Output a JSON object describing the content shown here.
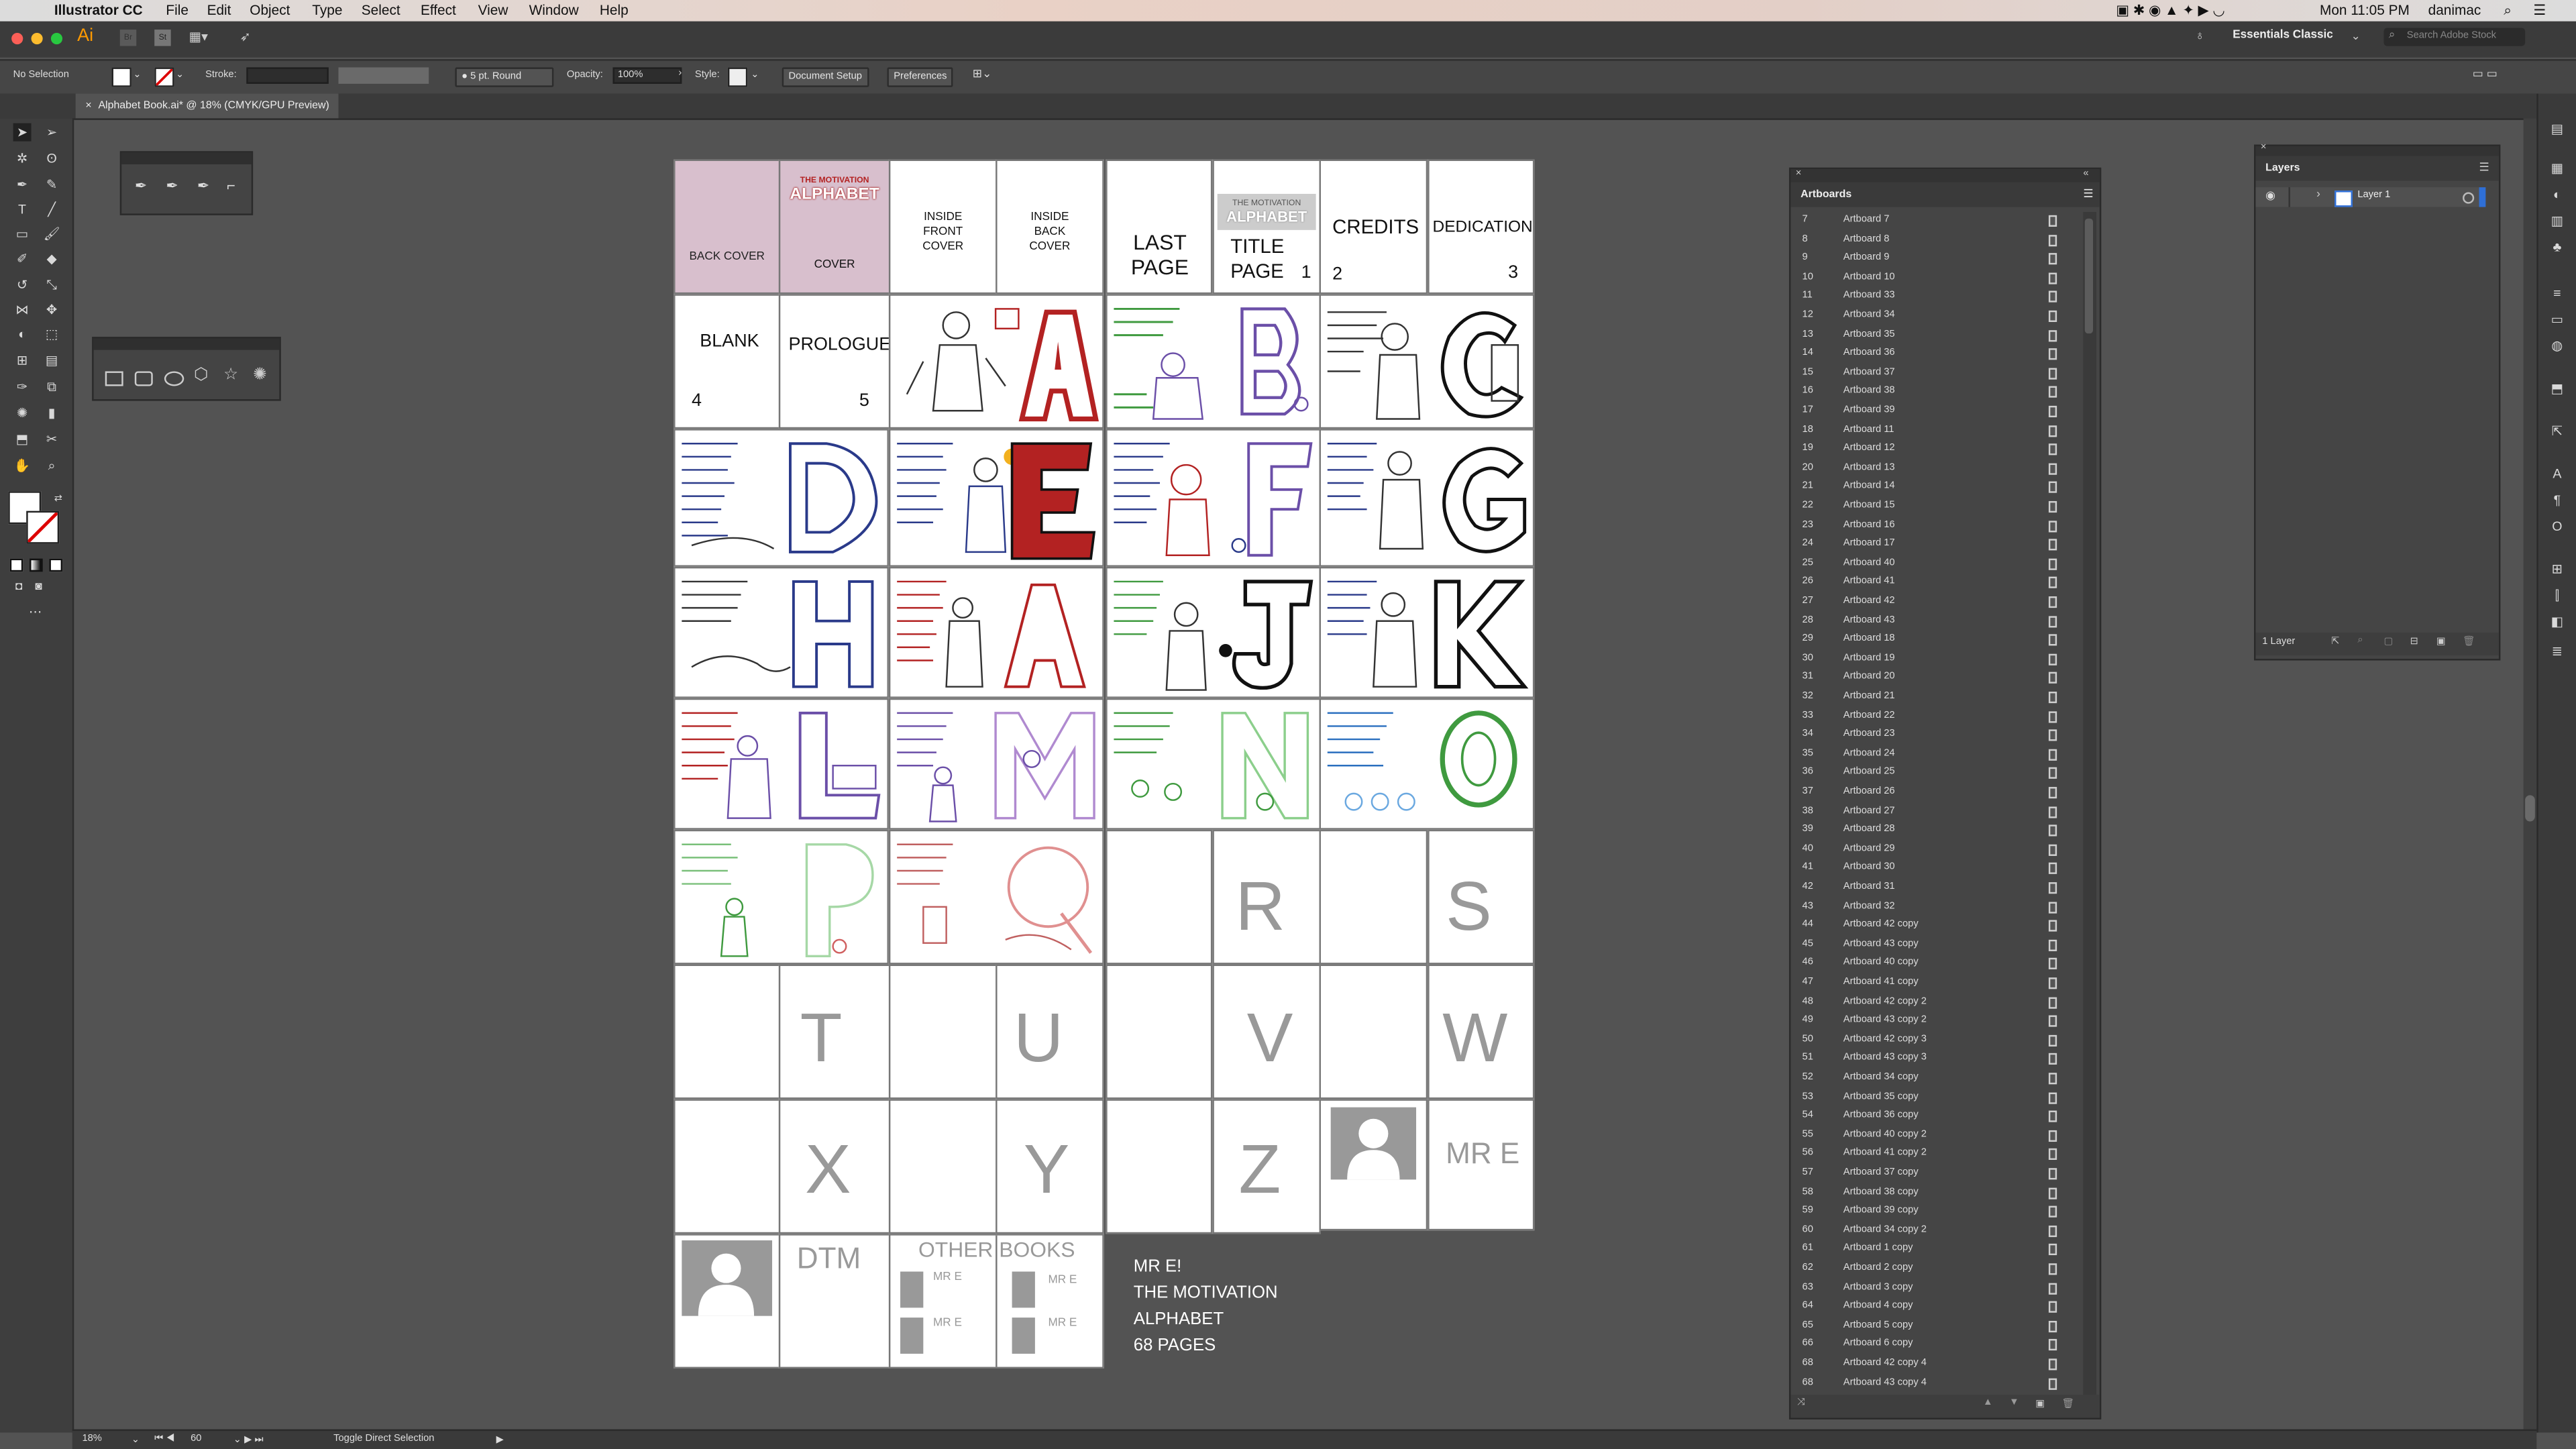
{
  "menubar": {
    "app": "Illustrator CC",
    "menus": [
      "File",
      "Edit",
      "Object",
      "Type",
      "Select",
      "Effect",
      "View",
      "Window",
      "Help"
    ],
    "clock": "Mon 11:05 PM",
    "user": "danimac"
  },
  "appbar": {
    "logo": "Ai",
    "br": "Br",
    "st": "St",
    "workspace": "Essentials Classic",
    "search_placeholder": "Search Adobe Stock"
  },
  "control_bar": {
    "selection": "No Selection",
    "stroke_label": "Stroke:",
    "brush": "5 pt. Round",
    "opacity_label": "Opacity:",
    "opacity_value": "100%",
    "style_label": "Style:",
    "document_setup": "Document Setup",
    "preferences": "Preferences"
  },
  "document_tab": {
    "title": "Alphabet Book.ai* @ 18% (CMYK/GPU Preview)"
  },
  "status_bar": {
    "zoom": "18%",
    "page": "60",
    "tool_hint": "Toggle Direct Selection"
  },
  "artboards": {
    "back_cover": "BACK COVER",
    "cover": "COVER",
    "cover_title_top": "THE MOTIVATION",
    "cover_title_bottom": "ALPHABET",
    "inside_front": "INSIDE FRONT COVER",
    "inside_back": "INSIDE BACK COVER",
    "last_page": "LAST PAGE",
    "title_page": "TITLE PAGE",
    "title_page_num": "1",
    "credits": "CREDITS",
    "credits_num": "2",
    "dedication": "DEDICATION",
    "dedication_num": "3",
    "blank": "BLANK",
    "blank_num": "4",
    "prologue": "PROLOGUE",
    "prologue_num": "5",
    "r": "R",
    "s": "S",
    "t": "T",
    "u": "U",
    "v": "V",
    "w": "W",
    "x": "X",
    "y": "Y",
    "z": "Z",
    "mr_e": "MR E",
    "dtm": "DTM",
    "other_books": "OTHER BOOKS",
    "book_label": "MR E",
    "info_line1": "MR E!",
    "info_line2": "THE MOTIVATION",
    "info_line3": "ALPHABET",
    "info_line4": "68 PAGES"
  },
  "artboards_panel": {
    "title": "Artboards",
    "rows": [
      {
        "n": "7",
        "name": "Artboard 7"
      },
      {
        "n": "8",
        "name": "Artboard 8"
      },
      {
        "n": "9",
        "name": "Artboard 9"
      },
      {
        "n": "10",
        "name": "Artboard 10"
      },
      {
        "n": "11",
        "name": "Artboard 33"
      },
      {
        "n": "12",
        "name": "Artboard 34"
      },
      {
        "n": "13",
        "name": "Artboard 35"
      },
      {
        "n": "14",
        "name": "Artboard 36"
      },
      {
        "n": "15",
        "name": "Artboard 37"
      },
      {
        "n": "16",
        "name": "Artboard 38"
      },
      {
        "n": "17",
        "name": "Artboard 39"
      },
      {
        "n": "18",
        "name": "Artboard 11"
      },
      {
        "n": "19",
        "name": "Artboard 12"
      },
      {
        "n": "20",
        "name": "Artboard 13"
      },
      {
        "n": "21",
        "name": "Artboard 14"
      },
      {
        "n": "22",
        "name": "Artboard 15"
      },
      {
        "n": "23",
        "name": "Artboard 16"
      },
      {
        "n": "24",
        "name": "Artboard 17"
      },
      {
        "n": "25",
        "name": "Artboard 40"
      },
      {
        "n": "26",
        "name": "Artboard 41"
      },
      {
        "n": "27",
        "name": "Artboard 42"
      },
      {
        "n": "28",
        "name": "Artboard 43"
      },
      {
        "n": "29",
        "name": "Artboard 18"
      },
      {
        "n": "30",
        "name": "Artboard 19"
      },
      {
        "n": "31",
        "name": "Artboard 20"
      },
      {
        "n": "32",
        "name": "Artboard 21"
      },
      {
        "n": "33",
        "name": "Artboard 22"
      },
      {
        "n": "34",
        "name": "Artboard 23"
      },
      {
        "n": "35",
        "name": "Artboard 24"
      },
      {
        "n": "36",
        "name": "Artboard 25"
      },
      {
        "n": "37",
        "name": "Artboard 26"
      },
      {
        "n": "38",
        "name": "Artboard 27"
      },
      {
        "n": "39",
        "name": "Artboard 28"
      },
      {
        "n": "40",
        "name": "Artboard 29"
      },
      {
        "n": "41",
        "name": "Artboard 30"
      },
      {
        "n": "42",
        "name": "Artboard 31"
      },
      {
        "n": "43",
        "name": "Artboard 32"
      },
      {
        "n": "44",
        "name": "Artboard 42 copy"
      },
      {
        "n": "45",
        "name": "Artboard 43 copy"
      },
      {
        "n": "46",
        "name": "Artboard 40 copy"
      },
      {
        "n": "47",
        "name": "Artboard 41 copy"
      },
      {
        "n": "48",
        "name": "Artboard 42 copy 2"
      },
      {
        "n": "49",
        "name": "Artboard 43 copy 2"
      },
      {
        "n": "50",
        "name": "Artboard 42 copy 3"
      },
      {
        "n": "51",
        "name": "Artboard 43 copy 3"
      },
      {
        "n": "52",
        "name": "Artboard 34 copy"
      },
      {
        "n": "53",
        "name": "Artboard 35 copy"
      },
      {
        "n": "54",
        "name": "Artboard 36 copy"
      },
      {
        "n": "55",
        "name": "Artboard 40 copy 2"
      },
      {
        "n": "56",
        "name": "Artboard 41 copy 2"
      },
      {
        "n": "57",
        "name": "Artboard 37 copy"
      },
      {
        "n": "58",
        "name": "Artboard 38 copy"
      },
      {
        "n": "59",
        "name": "Artboard 39 copy"
      },
      {
        "n": "60",
        "name": "Artboard 34 copy 2"
      },
      {
        "n": "61",
        "name": "Artboard 1 copy"
      },
      {
        "n": "62",
        "name": "Artboard 2 copy"
      },
      {
        "n": "63",
        "name": "Artboard 3 copy"
      },
      {
        "n": "64",
        "name": "Artboard 4 copy"
      },
      {
        "n": "65",
        "name": "Artboard 5 copy"
      },
      {
        "n": "66",
        "name": "Artboard 6 copy"
      },
      {
        "n": "68",
        "name": "Artboard 42 copy 4"
      },
      {
        "n": "68",
        "name": "Artboard 43 copy 4"
      }
    ]
  },
  "layers_panel": {
    "title": "Layers",
    "layer_name": "Layer 1",
    "footer": "1 Layer"
  },
  "colors": {
    "accent": "#2f6fd6",
    "cover_pink": "#d8bfcd",
    "sketch_red": "#b32222",
    "sketch_green": "#3f9a3f",
    "sketch_purple": "#6b4fa8"
  }
}
